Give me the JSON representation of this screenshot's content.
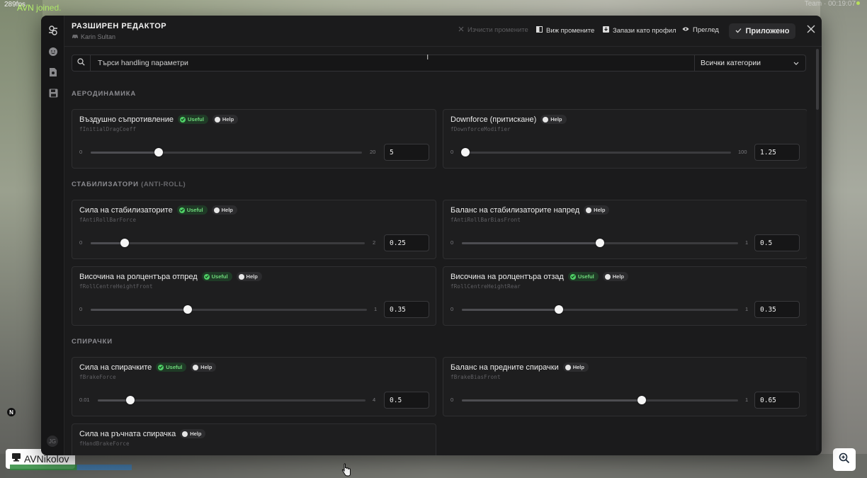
{
  "hud": {
    "fps": "289fps",
    "join_message": "AVN joined.",
    "corner_text": "Team · 00:19:07",
    "player_name": "AVNikolov",
    "map_marker": "N"
  },
  "editor": {
    "title": "РАЗШИРЕН РЕДАКТОР",
    "vehicle": "Karin Sultan",
    "actions": {
      "clear": "Изчисти промените",
      "view": "Виж промените",
      "save_profile": "Запази като профил",
      "preview": "Преглед",
      "applied": "Приложено"
    },
    "search": {
      "placeholder": "Търси handling параметри",
      "value": ""
    },
    "category": "Всички категории",
    "rail_avatar": "JG"
  },
  "badges": {
    "useful": "Useful",
    "help": "Help"
  },
  "sections": [
    {
      "title": "АЕРОДИНАМИКА",
      "subtitle": ""
    },
    {
      "title": "СТАБИЛИЗАТОРИ",
      "subtitle": "(ANTI-ROLL)"
    },
    {
      "title": "СПИРАЧКИ",
      "subtitle": ""
    }
  ],
  "params": [
    {
      "name": "Въздушно съпротивление",
      "code": "fInitialDragCoeff",
      "useful": true,
      "min": "0",
      "max": "20",
      "min_num": 0,
      "max_num": 20,
      "value": "5"
    },
    {
      "name": "Downforce (притискане)",
      "code": "fDownforceModifier",
      "useful": false,
      "min": "0",
      "max": "100",
      "min_num": 0,
      "max_num": 100,
      "value": "1.25"
    },
    {
      "name": "Сила на стабилизаторите",
      "code": "fAntiRollBarForce",
      "useful": true,
      "min": "0",
      "max": "2",
      "min_num": 0,
      "max_num": 2,
      "value": "0.25"
    },
    {
      "name": "Баланс на стабилизаторите напред",
      "code": "fAntiRollBarBiasFront",
      "useful": false,
      "min": "0",
      "max": "1",
      "min_num": 0,
      "max_num": 1,
      "value": "0.5"
    },
    {
      "name": "Височина на ролцентъра отпред",
      "code": "fRollCentreHeightFront",
      "useful": true,
      "min": "0",
      "max": "1",
      "min_num": 0,
      "max_num": 1,
      "value": "0.35"
    },
    {
      "name": "Височина на ролцентъра отзад",
      "code": "fRollCentreHeightRear",
      "useful": true,
      "min": "0",
      "max": "1",
      "min_num": 0,
      "max_num": 1,
      "value": "0.35"
    },
    {
      "name": "Сила на спирачките",
      "code": "fBrakeForce",
      "useful": true,
      "min": "0.01",
      "max": "4",
      "min_num": 0.01,
      "max_num": 4,
      "value": "0.5"
    },
    {
      "name": "Баланс на предните спирачки",
      "code": "fBrakeBiasFront",
      "useful": false,
      "min": "0",
      "max": "1",
      "min_num": 0,
      "max_num": 1,
      "value": "0.65"
    },
    {
      "name": "Сила на ръчната спирачка",
      "code": "fHandBrakeForce",
      "useful": false,
      "min": "",
      "max": "",
      "value": ""
    }
  ]
}
